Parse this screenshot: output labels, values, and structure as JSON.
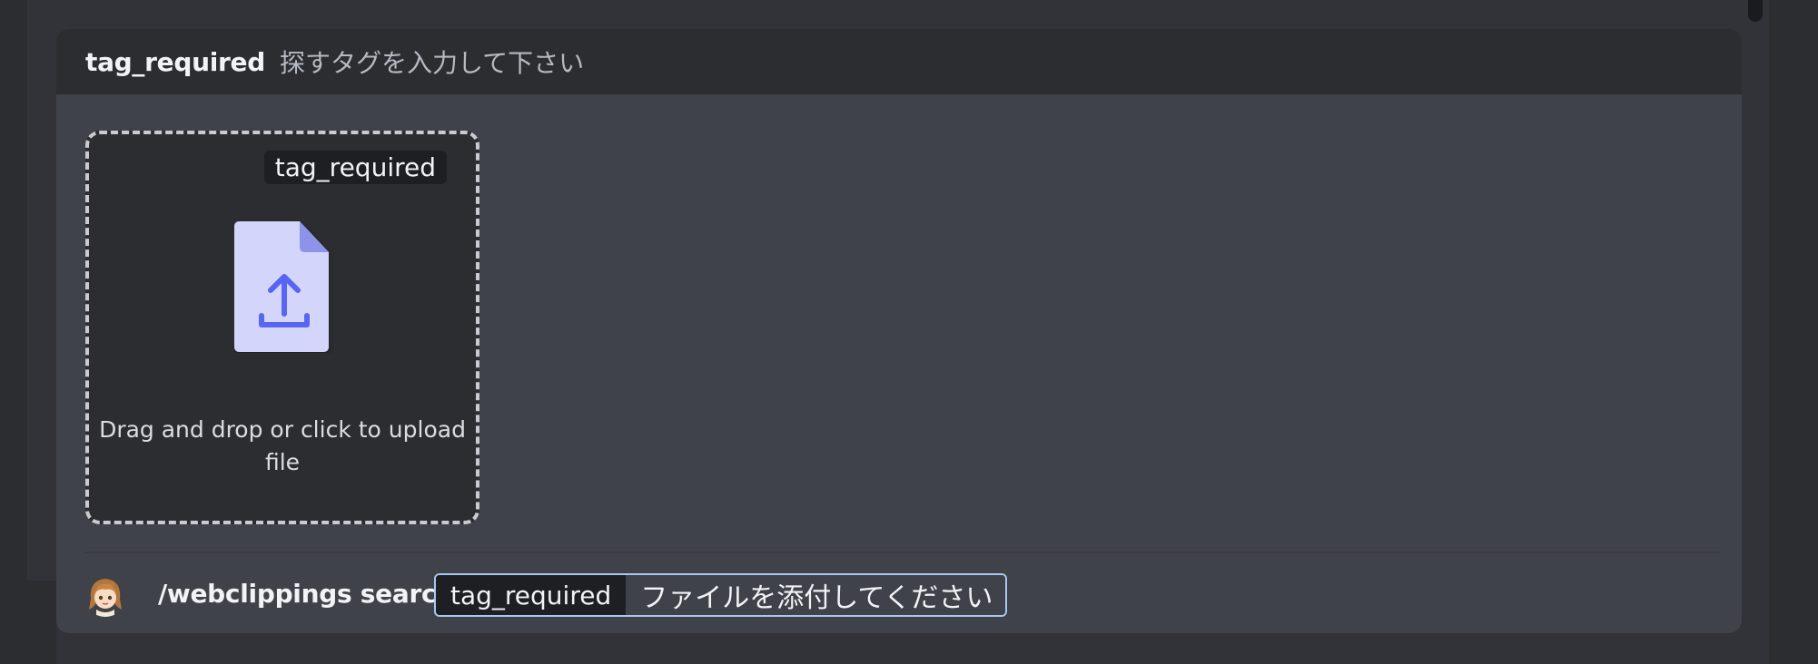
{
  "autocomplete": {
    "option_name": "tag_required",
    "option_description": "探すタグを入力して下さい"
  },
  "upload": {
    "tag_label": "tag_required",
    "prompt_text": "Drag and drop or click to upload file",
    "icon": "file-upload-icon"
  },
  "command_bar": {
    "command": "/webclippings search",
    "option_tag": "tag_required",
    "option_value": "ファイルを添付してください",
    "avatar": "avatar-image"
  },
  "colors": {
    "background": "#313338",
    "panel": "#404249",
    "header": "#2b2d31",
    "accent": "#5865f2",
    "upload_icon_fill": "#d3d5fb",
    "focus_border": "#a7c8f5"
  }
}
